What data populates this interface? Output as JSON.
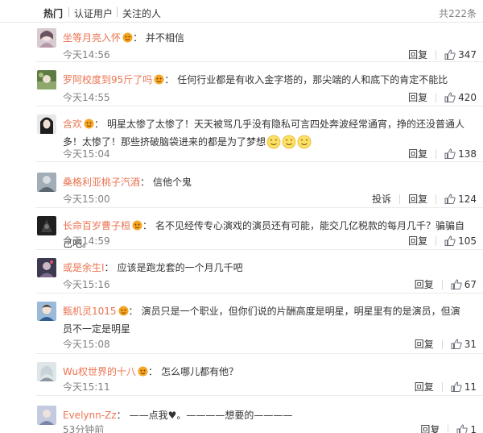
{
  "tabs": [
    {
      "label": "热门",
      "active": true
    },
    {
      "label": "认证用户",
      "active": false
    },
    {
      "label": "关注的人",
      "active": false
    }
  ],
  "total_count": "共222条",
  "actions": {
    "reply": "回复",
    "report": "投诉"
  },
  "comments": [
    {
      "user": "坐等月亮入怀",
      "text": "并不相信",
      "time": "今天14:56",
      "likes": "347",
      "avatar_color": "#c9b8c2"
    },
    {
      "user": "罗阿校度到95斤了吗",
      "text": "任何行业都是有收入金字塔的，那尖端的人和底下的肯定不能比",
      "time": "今天14:55",
      "likes": "420",
      "avatar_color": "#7a8c5a"
    },
    {
      "user": "含欢",
      "text": "明星太惨了太惨了！天天被骂几乎没有隐私可言四处奔波经常通宵，挣的还没普通人多！太惨了！那些挤破脑袋进来的都是为了梦想",
      "time": "今天15:04",
      "likes": "138",
      "avatar_color": "#3a3a3a"
    },
    {
      "user": "桑格利亚桃子汽酒",
      "text": "信他个鬼",
      "time": "今天15:00",
      "likes": "124",
      "avatar_color": "#8f9aa6"
    },
    {
      "user": "长命百岁曹子桓",
      "text": "名不见经传专心演戏的演员还有可能，能交几亿税款的每月几千？骗骗自己吧。",
      "time": "今天14:59",
      "likes": "105",
      "avatar_color": "#2b2b2b"
    },
    {
      "user": "或是余生I",
      "text": "应该是跑龙套的一个月几千吧",
      "time": "今天15:16",
      "likes": "67",
      "avatar_color": "#4e4a5c"
    },
    {
      "user": "甄机灵1015",
      "text": "演员只是一个职业，但你们说的片酬高度是明星，明星里有的是演员，但演员不一定是明星",
      "time": "今天15:08",
      "likes": "31",
      "avatar_color": "#6a8fb5"
    },
    {
      "user": "Wu权世界的十八",
      "text": "怎么哪儿都有他？",
      "time": "今天15:11",
      "likes": "11",
      "avatar_color": "#b7c3cc"
    },
    {
      "user": "Evelynn-Zz",
      "text": "——点我♥。————想要的————",
      "time": "53分钟前",
      "likes": "1",
      "avatar_color": "#9aa4c0"
    }
  ]
}
